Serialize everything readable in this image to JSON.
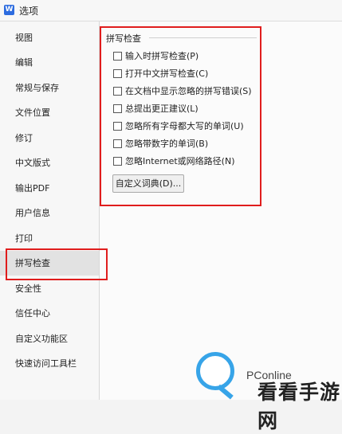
{
  "window": {
    "app_icon": "W",
    "title": "选项"
  },
  "sidebar": {
    "items": [
      {
        "label": "视图"
      },
      {
        "label": "编辑"
      },
      {
        "label": "常规与保存"
      },
      {
        "label": "文件位置"
      },
      {
        "label": "修订"
      },
      {
        "label": "中文版式"
      },
      {
        "label": "输出PDF"
      },
      {
        "label": "用户信息"
      },
      {
        "label": "打印"
      },
      {
        "label": "拼写检查",
        "selected": true
      },
      {
        "label": "安全性"
      },
      {
        "label": "信任中心"
      },
      {
        "label": "自定义功能区"
      },
      {
        "label": "快速访问工具栏"
      }
    ]
  },
  "spell_check": {
    "group_title": "拼写检查",
    "options": [
      {
        "label": "输入时拼写检查(P)",
        "checked": false
      },
      {
        "label": "打开中文拼写检查(C)",
        "checked": false
      },
      {
        "label": "在文档中显示忽略的拼写错误(S)",
        "checked": false
      },
      {
        "label": "总提出更正建议(L)",
        "checked": false
      },
      {
        "label": "忽略所有字母都大写的单词(U)",
        "checked": false
      },
      {
        "label": "忽略带数字的单词(B)",
        "checked": false
      },
      {
        "label": "忽略Internet或网络路径(N)",
        "checked": false
      }
    ],
    "custom_dict_button": "自定义词典(D)..."
  },
  "watermark": {
    "brand": "PConline",
    "site": "看看手游网"
  },
  "colors": {
    "highlight": "#e01d1d",
    "watermark_blue": "#37a4e8",
    "selected_bg": "#e2e2e2"
  }
}
